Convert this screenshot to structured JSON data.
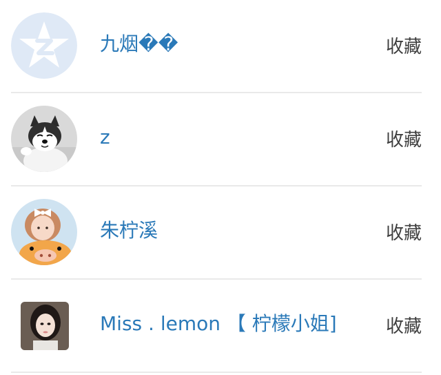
{
  "follow_list": {
    "items": [
      {
        "avatar_icon": "default-qq-star-avatar-icon",
        "name": "九烟��",
        "action_label": "收藏"
      },
      {
        "avatar_icon": "husky-dog-photo-avatar",
        "name": "z",
        "action_label": "收藏"
      },
      {
        "avatar_icon": "girl-with-plush-toy-photo-avatar",
        "name": "朱柠溪",
        "action_label": "收藏"
      },
      {
        "avatar_icon": "girl-portrait-photo-avatar",
        "name": "Miss . lemon 【 柠檬小姐]",
        "action_label": "收藏"
      }
    ]
  },
  "colors": {
    "name_link": "#2a79b8",
    "action_text": "#3f3f3f",
    "divider": "#e9e9e9",
    "default_avatar_bg": "#dfe9f6"
  }
}
